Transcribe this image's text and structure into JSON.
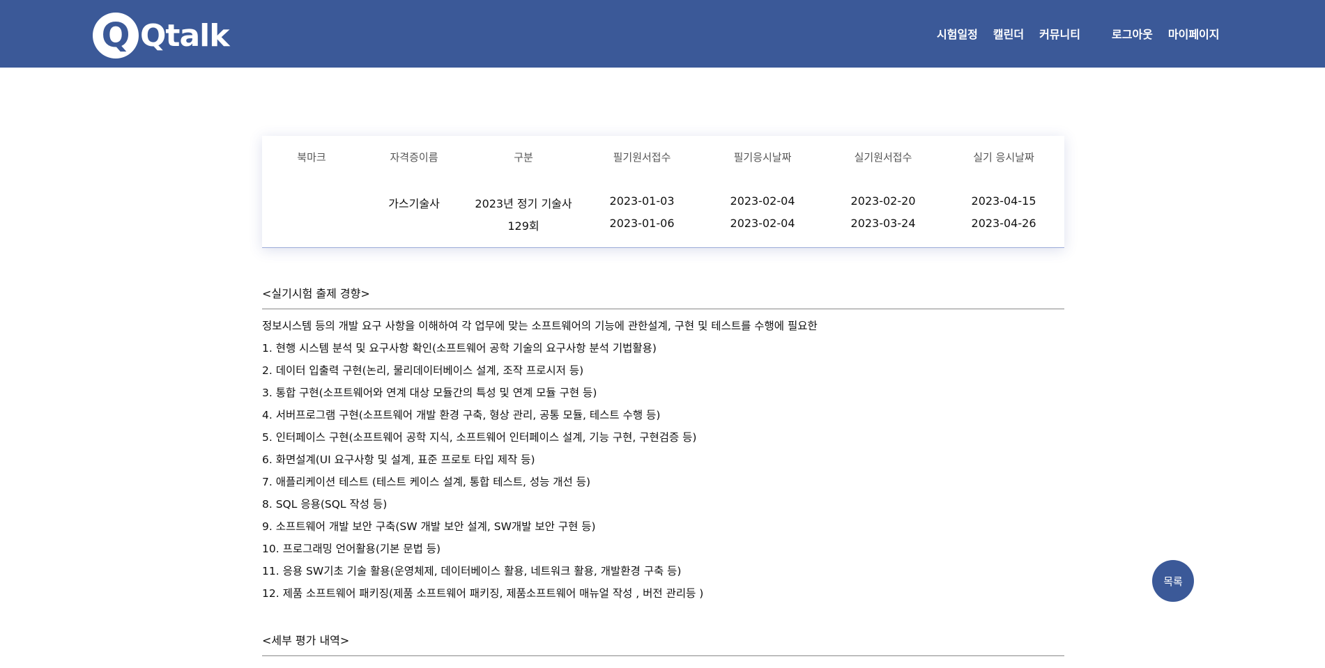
{
  "header": {
    "logo_letter": "Q",
    "logo_text": "Qtalk",
    "nav_main": [
      "시험일정",
      "캘린더",
      "커뮤니티"
    ],
    "nav_user": [
      "로그아웃",
      "마이페이지"
    ]
  },
  "schedule": {
    "columns": [
      "북마크",
      "자격증이름",
      "구분",
      "필기원서접수",
      "필기응시날짜",
      "실기원서접수",
      "실기 응시날짜"
    ],
    "name": "가스기술사",
    "round_line1": "2023년 정기 기술사",
    "round_line2": "129회",
    "written_apply_start": "2023-01-03",
    "written_apply_end": "2023-01-06",
    "written_exam_start": "2023-02-04",
    "written_exam_end": "2023-02-04",
    "practical_apply_start": "2023-02-20",
    "practical_apply_end": "2023-03-24",
    "practical_exam_start": "2023-04-15",
    "practical_exam_end": "2023-04-26"
  },
  "content": {
    "trend_title": "<실기시험 출제 경향>",
    "lines": [
      "정보시스템 등의 개발 요구 사항을 이해하여 각 업무에 맞는 소프트웨어의 기능에 관한설계, 구현 및 테스트를 수행에 필요한",
      "1. 현행 시스템 분석 및 요구사항 확인(소프트웨어 공학 기술의 요구사항 분석 기법활용)",
      "2. 데이터 입출력 구현(논리, 물리데이터베이스 설계, 조작 프로시저 등)",
      "3. 통합 구현(소프트웨어와 연계 대상 모듈간의 특성 및 연계 모듈 구현 등)",
      "4. 서버프로그램 구현(소프트웨어 개발 환경 구축, 형상 관리, 공통 모듈, 테스트 수행 등)",
      "5. 인터페이스 구현(소프트웨어 공학 지식, 소프트웨어 인터페이스 설계, 기능 구현, 구현검증 등)",
      "6. 화면설계(UI 요구사항 및 설계, 표준 프로토 타입 제작 등)",
      "7. 애플리케이션 테스트 (테스트 케이스 설계, 통합 테스트, 성능 개선 등)",
      "8. SQL 응용(SQL 작성 등)",
      "9. 소프트웨어 개발 보안 구축(SW 개발 보안 설계, SW개발 보안 구현 등)",
      "10. 프로그래밍 언어활용(기본 문법 등)",
      "11. 응용 SW기초 기술 활용(운영체제, 데이터베이스 활용, 네트워크 활용, 개발환경 구축 등)",
      "12. 제품 소프트웨어 패키징(제품 소프트웨어 패키징, 제품소프트웨어 매뉴얼 작성 , 버전 관리등 )"
    ],
    "detail_title": "<세부 평가 내역>"
  },
  "fab_label": "목록"
}
